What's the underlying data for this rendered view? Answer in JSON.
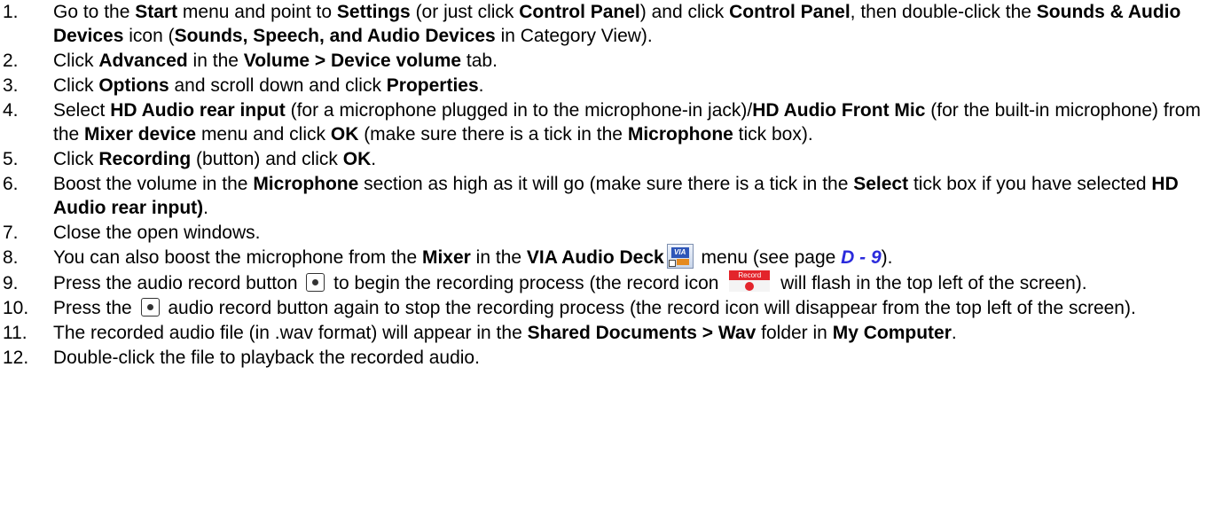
{
  "steps": [
    {
      "num": "1.",
      "segments": [
        {
          "t": "Go to the "
        },
        {
          "t": "Start",
          "b": true
        },
        {
          "t": " menu and point to "
        },
        {
          "t": "Settings",
          "b": true
        },
        {
          "t": " (or just click "
        },
        {
          "t": "Control Panel",
          "b": true
        },
        {
          "t": ") and click "
        },
        {
          "t": "Control Panel",
          "b": true
        },
        {
          "t": ", then double-click the "
        },
        {
          "t": "Sounds & Audio Devices",
          "b": true
        },
        {
          "t": " icon ("
        },
        {
          "t": "Sounds, Speech, and Audio Devices",
          "b": true
        },
        {
          "t": " in Category View)."
        }
      ]
    },
    {
      "num": "2.",
      "segments": [
        {
          "t": "Click "
        },
        {
          "t": "Advanced",
          "b": true
        },
        {
          "t": " in the "
        },
        {
          "t": "Volume > Device volume",
          "b": true
        },
        {
          "t": " tab."
        }
      ]
    },
    {
      "num": "3.",
      "segments": [
        {
          "t": "Click "
        },
        {
          "t": "Options",
          "b": true
        },
        {
          "t": " and scroll down and click "
        },
        {
          "t": "Properties",
          "b": true
        },
        {
          "t": "."
        }
      ]
    },
    {
      "num": "4.",
      "segments": [
        {
          "t": "Select "
        },
        {
          "t": "HD Audio rear input",
          "b": true
        },
        {
          "t": " (for a microphone plugged in to the microphone-in jack)/"
        },
        {
          "t": "HD Audio Front Mic",
          "b": true
        },
        {
          "t": " (for the built-in microphone) from the "
        },
        {
          "t": "Mixer device",
          "b": true
        },
        {
          "t": " menu and click "
        },
        {
          "t": "OK",
          "b": true
        },
        {
          "t": " (make sure there is a tick in the "
        },
        {
          "t": "Microphone",
          "b": true
        },
        {
          "t": " tick box)."
        }
      ]
    },
    {
      "num": "5.",
      "segments": [
        {
          "t": "Click "
        },
        {
          "t": "Recording",
          "b": true
        },
        {
          "t": " (button) and click "
        },
        {
          "t": "OK",
          "b": true
        },
        {
          "t": "."
        }
      ]
    },
    {
      "num": "6.",
      "segments": [
        {
          "t": "Boost the volume in the "
        },
        {
          "t": "Microphone",
          "b": true
        },
        {
          "t": " section as high as it will go (make sure there is a tick in the "
        },
        {
          "t": "Select",
          "b": true
        },
        {
          "t": " tick box if you have selected "
        },
        {
          "t": "HD Audio rear input)",
          "b": true
        },
        {
          "t": "."
        }
      ]
    },
    {
      "num": "7.",
      "segments": [
        {
          "t": "Close the open windows."
        }
      ]
    },
    {
      "num": "8.",
      "segments": [
        {
          "t": "You can also boost the microphone from the "
        },
        {
          "t": "Mixer",
          "b": true
        },
        {
          "t": " in the "
        },
        {
          "t": "VIA Audio Deck",
          "b": true
        },
        {
          "icon": "via-audio-deck-icon"
        },
        {
          "t": " menu (see page "
        },
        {
          "t": "D - 9",
          "link": true
        },
        {
          "t": ")."
        }
      ]
    },
    {
      "num": "9.",
      "segments": [
        {
          "t": "Press the audio record button "
        },
        {
          "icon": "record-button-icon"
        },
        {
          "t": " to begin the recording process (the record icon "
        },
        {
          "icon": "record-status-icon",
          "label": "Record"
        },
        {
          "t": " will flash in the top left of the screen)."
        }
      ]
    },
    {
      "num": "10.",
      "segments": [
        {
          "t": "Press the "
        },
        {
          "icon": "record-button-icon"
        },
        {
          "t": " audio record button again to stop the recording process (the record icon will disappear from the top left of the screen)."
        }
      ]
    },
    {
      "num": "11.",
      "segments": [
        {
          "t": "The recorded audio file (in .wav format) will appear in the "
        },
        {
          "t": "Shared Documents > Wav",
          "b": true
        },
        {
          "t": " folder in "
        },
        {
          "t": "My Computer",
          "b": true
        },
        {
          "t": "."
        }
      ]
    },
    {
      "num": "12.",
      "segments": [
        {
          "t": "Double-click the file to playback the recorded audio."
        }
      ]
    }
  ],
  "colors": {
    "text": "#000000",
    "link": "#2b2bdc",
    "record_red": "#e3242b"
  }
}
